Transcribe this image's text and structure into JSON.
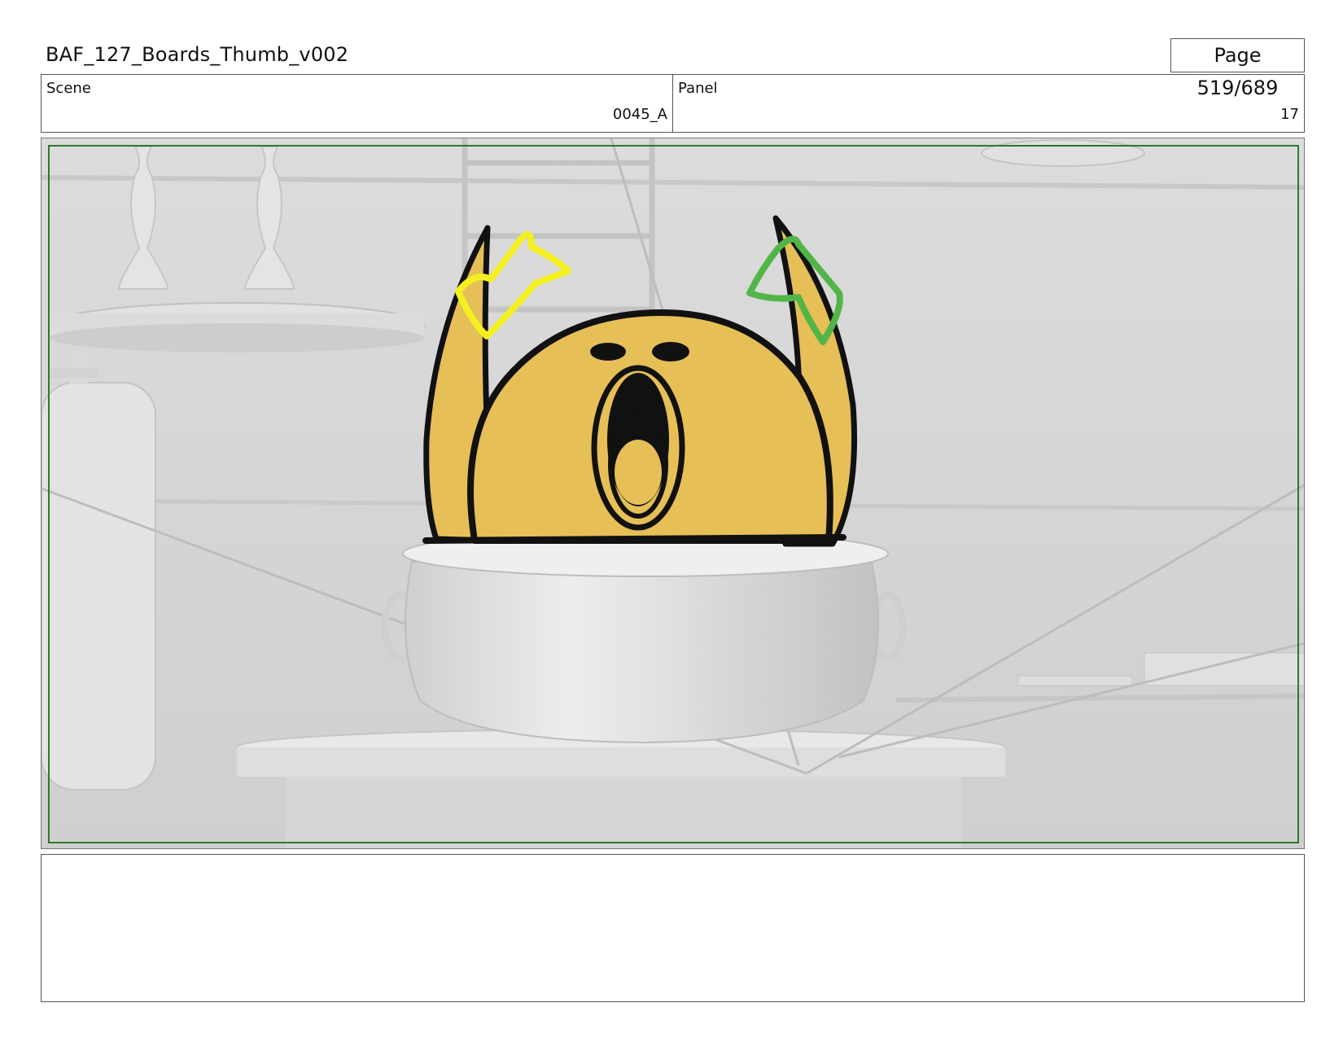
{
  "header": {
    "document_title": "BAF_127_Boards_Thumb_v002",
    "page_counter": "Page 519/689"
  },
  "info": {
    "scene_label": "Scene",
    "scene_value": "0045_A",
    "panel_label": "Panel",
    "panel_value": "17"
  },
  "panel_image": {
    "description_icon": "storyboard-drawing",
    "colors": {
      "background": "#d9d9d9",
      "character_fill": "#e6bf57",
      "safe_area_border": "#2a7a2a",
      "yellow_sketch": "#f4f020",
      "green_sketch": "#52b548"
    }
  },
  "notes": {
    "text": ""
  }
}
